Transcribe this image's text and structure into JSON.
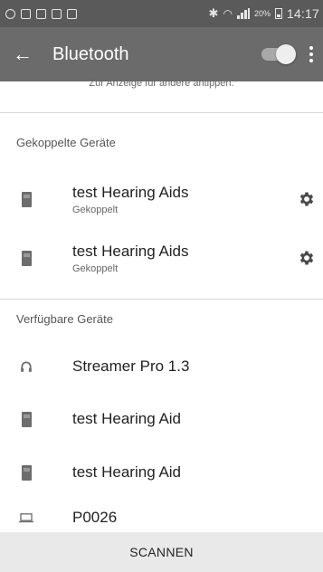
{
  "status_bar": {
    "battery_percent": "20%",
    "time": "14:17"
  },
  "app_bar": {
    "title": "Bluetooth",
    "bluetooth_enabled": true
  },
  "visibility_hint": "Zur Anzeige für andere antippen.",
  "paired_section": {
    "header": "Gekoppelte Geräte",
    "devices": [
      {
        "name": "test Hearing Aids",
        "status": "Gekoppelt",
        "icon": "hearing-aid-icon"
      },
      {
        "name": "test Hearing Aids",
        "status": "Gekoppelt",
        "icon": "hearing-aid-icon"
      }
    ]
  },
  "available_section": {
    "header": "Verfügbare Geräte",
    "devices": [
      {
        "name": "Streamer Pro 1.3",
        "icon": "headphones-icon"
      },
      {
        "name": "test Hearing Aid",
        "icon": "hearing-aid-icon"
      },
      {
        "name": "test Hearing Aid",
        "icon": "hearing-aid-icon"
      },
      {
        "name": "P0026",
        "icon": "laptop-icon"
      }
    ]
  },
  "scan_button": {
    "label": "SCANNEN"
  },
  "colors": {
    "status_bar_bg": "#5a5a5a",
    "app_bar_bg": "#6b6b6b",
    "icon_gray": "#6d6d6d",
    "scan_bar_bg": "#e9e9e9"
  }
}
